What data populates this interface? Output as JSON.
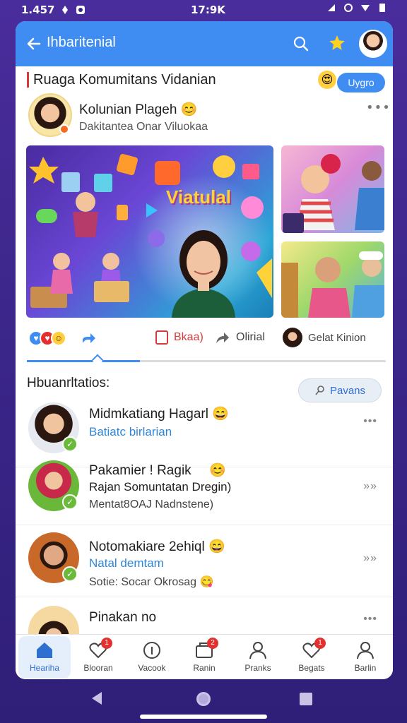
{
  "status_bar": {
    "time_left": "1.457",
    "time_center": "17:9K"
  },
  "app_bar": {
    "title": "Ihbaritenial"
  },
  "section": {
    "title": "Ruaga Komumitans Vidanian",
    "pill_label": "Uygro"
  },
  "post": {
    "author_name": "Kolunian Plageh",
    "author_sub": "Dakitantea Onar Viluokaa",
    "hero_text": "Viatulal"
  },
  "actions": {
    "save_label": "Bkaa)",
    "share_label": "Olirial",
    "commenter_label": "Gelat Kinion"
  },
  "list": {
    "title": "Hbuanrltatios:",
    "search_pill": "Pavans",
    "items": [
      {
        "line1": "Midmkatiang Hagarl",
        "line2": "Batiatc birlarian",
        "line3": ""
      },
      {
        "line1": "Pakamier ! Ragik",
        "line2": "Rajan Somuntatan Dregin)",
        "line3": "Mentat8OAJ Nadnstene)"
      },
      {
        "line1": "Notomakiare 2ehiql",
        "line2": "Natal demtam",
        "line3": "Sotie: Socar Okrosag"
      },
      {
        "line1": "Pinakan no",
        "line2": "",
        "line3": ""
      }
    ]
  },
  "bottom_nav": {
    "items": [
      {
        "label": "Heariha",
        "badge": ""
      },
      {
        "label": "Blooran",
        "badge": "1"
      },
      {
        "label": "Vacook",
        "badge": ""
      },
      {
        "label": "Ranin",
        "badge": "2"
      },
      {
        "label": "Pranks",
        "badge": ""
      },
      {
        "label": "Begats",
        "badge": "1"
      },
      {
        "label": "Barlin",
        "badge": ""
      }
    ]
  },
  "colors": {
    "accent": "#3f8df2",
    "badge": "#e3302f",
    "verified": "#6cba3c",
    "background": "#3a2588"
  }
}
